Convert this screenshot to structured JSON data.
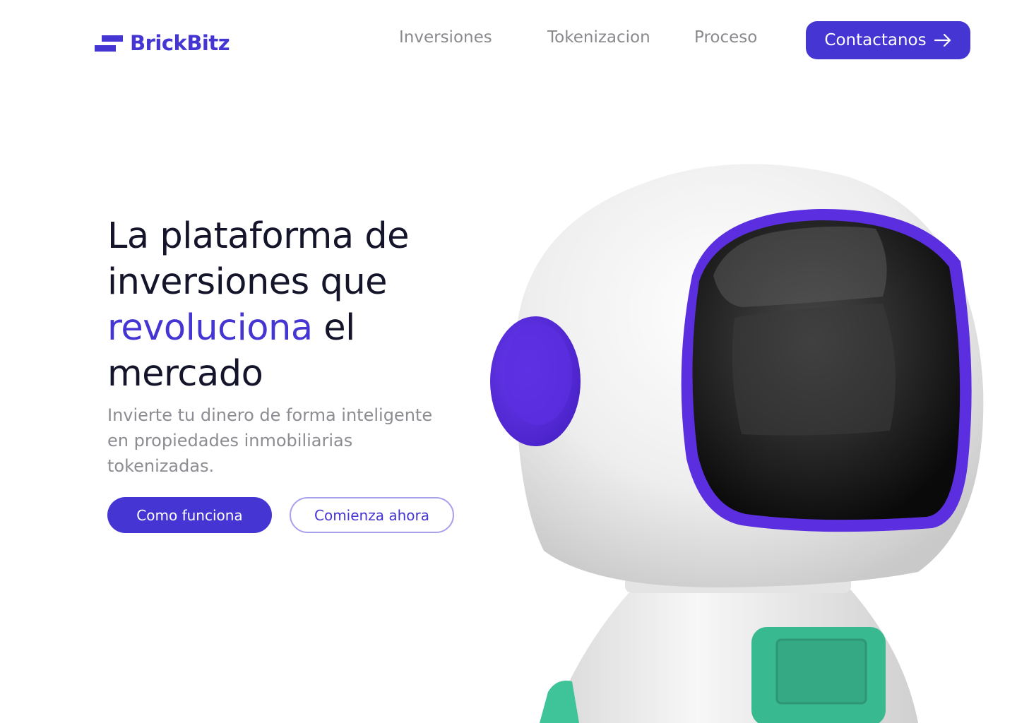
{
  "brand": {
    "name": "BrickBitz",
    "color": "#4535d3"
  },
  "nav": {
    "items": [
      {
        "label": "Inversiones"
      },
      {
        "label": "Tokenizacion"
      },
      {
        "label": "Proceso"
      }
    ],
    "cta_label": "Contactanos",
    "cta_icon": "arrow-right-icon"
  },
  "hero": {
    "title_line1": "La plataforma de",
    "title_line2": "inversiones que",
    "title_accent": "revoluciona",
    "title_after_accent": " el",
    "title_line4": "mercado",
    "subtitle": "Invierte tu dinero de forma inteligente en propiedades inmobiliarias tokenizadas.",
    "primary_button": "Como funciona",
    "secondary_button": "Comienza ahora"
  },
  "illustration": {
    "name": "astronaut-robot",
    "colors": {
      "body": "#f2f2f2",
      "visor_rim": "#5b2ee0",
      "ear": "#5b2ee0",
      "chest": "#39b98f"
    }
  }
}
